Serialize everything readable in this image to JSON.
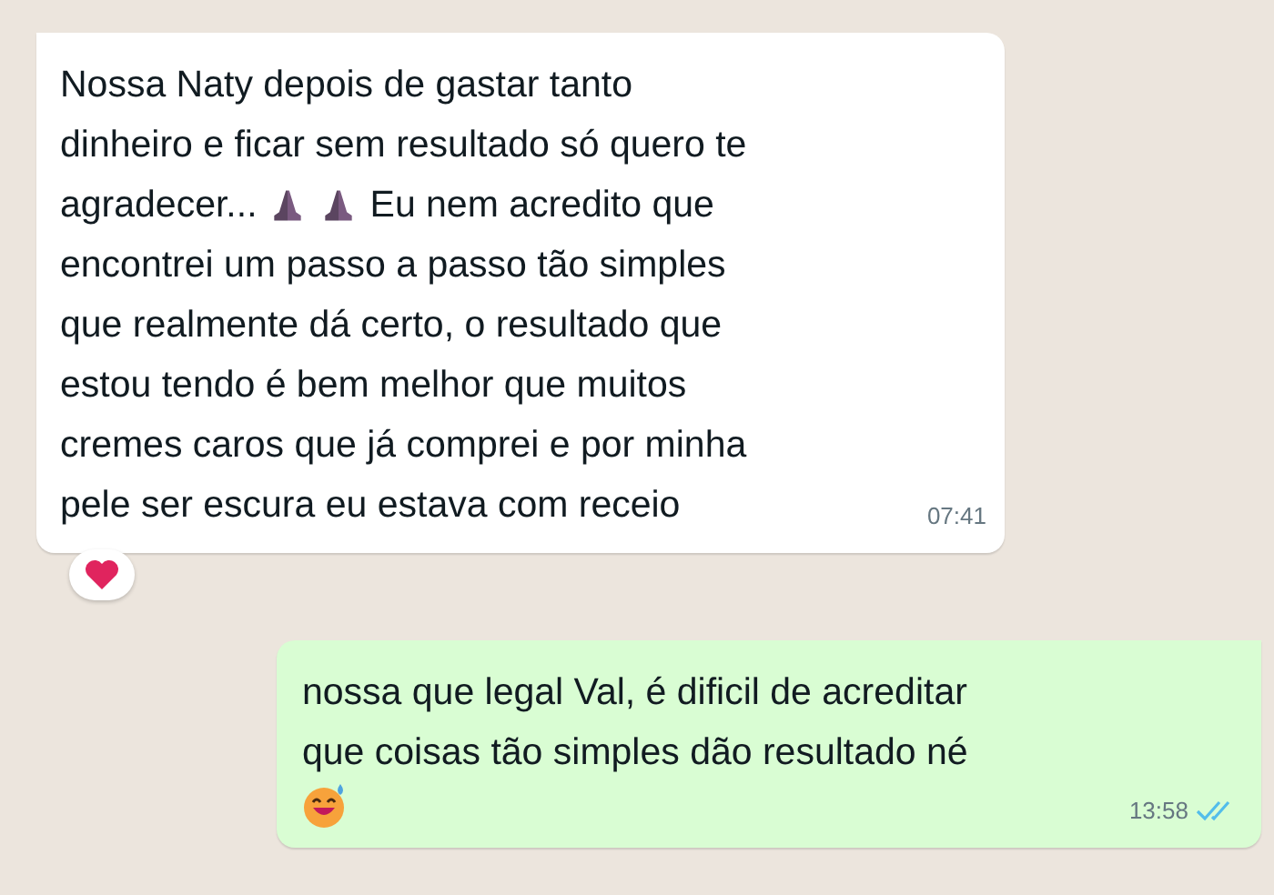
{
  "messages": [
    {
      "kind": "incoming",
      "lines": [
        [
          {
            "kind": "text",
            "text": "Nossa Naty depois de gastar tanto"
          }
        ],
        [
          {
            "kind": "text",
            "text": "dinheiro e ficar sem resultado só quero te"
          }
        ],
        [
          {
            "kind": "text",
            "text": "agradecer..."
          },
          {
            "kind": "pray"
          },
          {
            "kind": "pray"
          },
          {
            "kind": "text",
            "text": "Eu nem acredito que"
          }
        ],
        [
          {
            "kind": "text",
            "text": "encontrei um passo a passo tão simples"
          }
        ],
        [
          {
            "kind": "text",
            "text": "que realmente dá certo, o resultado que"
          }
        ],
        [
          {
            "kind": "text",
            "text": "estou tendo é bem melhor que muitos"
          }
        ],
        [
          {
            "kind": "text",
            "text": "cremes caros que já comprei e por minha"
          }
        ],
        [
          {
            "kind": "text",
            "text": "pele ser escura eu estava com receio"
          }
        ]
      ],
      "time": "07:41",
      "reactions": [
        {
          "kind": "heart"
        }
      ]
    },
    {
      "kind": "outgoing",
      "lines": [
        [
          {
            "kind": "text",
            "text": "nossa que legal Val, é dificil de acreditar"
          }
        ],
        [
          {
            "kind": "text",
            "text": "que coisas tão simples dão resultado né"
          }
        ],
        [
          {
            "kind": "grin"
          }
        ]
      ],
      "time": "13:58",
      "read": true
    }
  ]
}
